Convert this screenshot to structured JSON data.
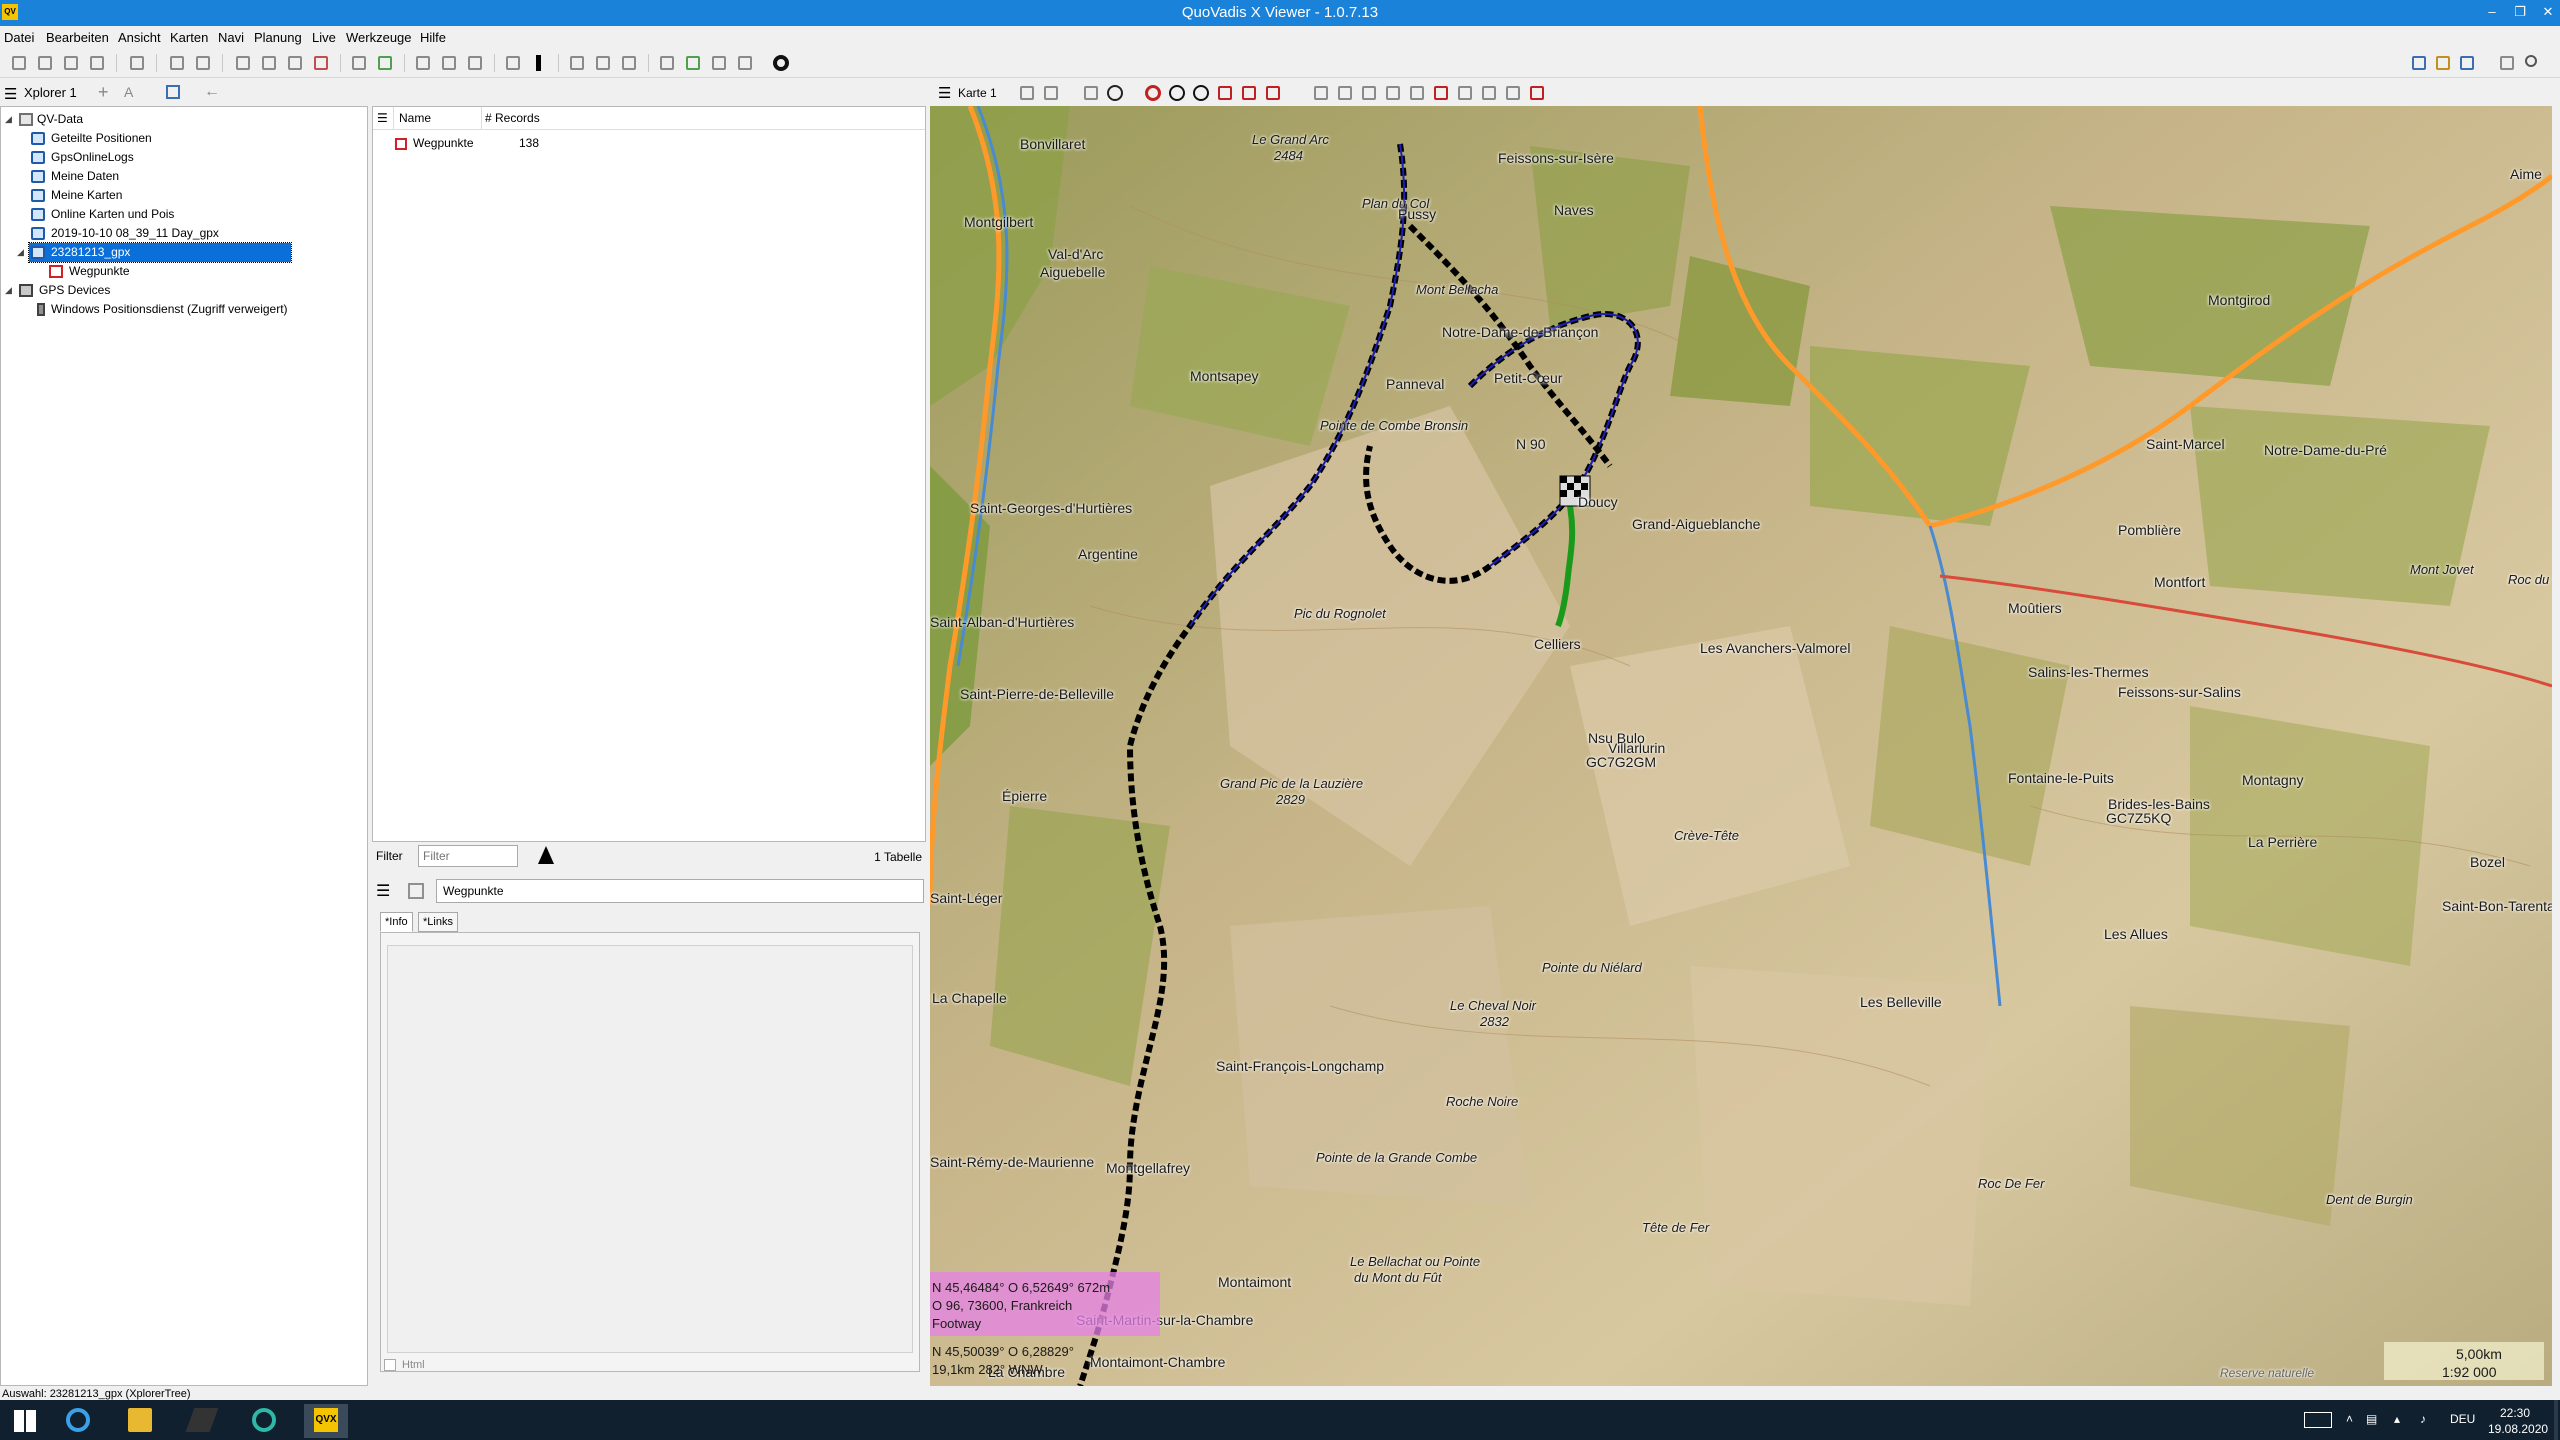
{
  "window": {
    "title": "QuoVadis X Viewer - 1.0.7.13",
    "app_badge": "QV"
  },
  "menu": [
    "Datei",
    "Bearbeiten",
    "Ansicht",
    "Karten",
    "Navi",
    "Planung",
    "Live",
    "Werkzeuge",
    "Hilfe"
  ],
  "explorer": {
    "title": "Xplorer 1",
    "tree": [
      {
        "label": "QV-Data",
        "level": 0,
        "icon": "folder-icon",
        "expanded": true
      },
      {
        "label": "Geteilte Positionen",
        "level": 1,
        "icon": "database-icon"
      },
      {
        "label": "GpsOnlineLogs",
        "level": 1,
        "icon": "database-icon"
      },
      {
        "label": "Meine Daten",
        "level": 1,
        "icon": "database-icon"
      },
      {
        "label": "Meine Karten",
        "level": 1,
        "icon": "database-icon"
      },
      {
        "label": "Online Karten und Pois",
        "level": 1,
        "icon": "database-icon"
      },
      {
        "label": "2019-10-10 08_39_11 Day_gpx",
        "level": 1,
        "icon": "database-icon"
      },
      {
        "label": "23281213_gpx",
        "level": 1,
        "icon": "database-icon",
        "selected": true,
        "expanded": true
      },
      {
        "label": "Wegpunkte",
        "level": 2,
        "icon": "waypoint-icon"
      },
      {
        "label": "GPS Devices",
        "level": 0,
        "icon": "device-icon",
        "expanded": true
      },
      {
        "label": "Windows Positionsdienst (Zugriff verweigert)",
        "level": 1,
        "icon": "phone-icon"
      }
    ]
  },
  "table": {
    "columns": [
      "Name",
      "# Records"
    ],
    "rows": [
      {
        "name": "Wegpunkte",
        "records": "138"
      }
    ]
  },
  "filter": {
    "label": "Filter",
    "placeholder": "Filter",
    "count": "1 Tabelle"
  },
  "detail": {
    "title": "Wegpunkte",
    "tabs": [
      "*Info",
      "*Links"
    ],
    "html_label": "Html"
  },
  "status": {
    "text": "Auswahl: 23281213_gpx   (XplorerTree)"
  },
  "map_panel": {
    "title": "Karte 1"
  },
  "map": {
    "labels": [
      "Bonvillaret",
      "Le Grand Arc",
      "2484",
      "Feissons-sur-Isère",
      "Plan du Col",
      "Pussy",
      "Naves",
      "Montgilbert",
      "Val-d'Arc",
      "Aiguebelle",
      "Mont Bellacha",
      "Notre-Dame-de-Briançon",
      "Montgirod",
      "Montsapey",
      "Pointe de Combe Bronsin",
      "Panneval",
      "Petit-Cœur",
      "Saint-Marcel",
      "Notre-Dame-du-Pré",
      "Saint-Georges-d'Hurtières",
      "Doucy",
      "Grand-Aigueblanche",
      "Pomblière",
      "Argentine",
      "Mont Jovet",
      "Montfort",
      "Roc du",
      "Pic du Rognolet",
      "Moûtiers",
      "Saint-Alban-d'Hurtières",
      "Celliers",
      "Les Avanchers-Valmorel",
      "Salins-les-Thermes",
      "Saint-Pierre-de-Belleville",
      "Feissons-sur-Salins",
      "Grand Pic de la Lauzière",
      "2829",
      "Fontaine-le-Puits",
      "Montagny",
      "Épierre",
      "Crève-Tête",
      "Brides-les-Bains",
      "La Perrière",
      "Bozel",
      "Saint-Léger",
      "Saint-Bon-Tarentaise",
      "Les Allues",
      "Pointe du Niélard",
      "La Chapelle",
      "Le Cheval Noir",
      "2832",
      "Les Belleville",
      "Saint-François-Longchamp",
      "Roche Noire",
      "Saint-Rémy-de-Maurienne",
      "Montgellafrey",
      "Pointe de la Grande Combe",
      "Roc De Fer",
      "Dent de Burgin",
      "Tête de Fer",
      "Montaimont",
      "Le Bellachat ou Pointe",
      "du Mont du Fût",
      "Saint-Martin-sur-la-Chambre",
      "Villarlurin",
      "GC7G2GM",
      "GC7Z5KQ",
      "Nsu Bulo",
      "N 90",
      "Aime",
      "Reserve naturelle",
      "Montaimont-Chambre",
      "La Chambre"
    ],
    "coords": [
      "N 45,46484° O 6,52649° 672m",
      "O 96, 73600, Frankreich",
      "Footway",
      "N 45,50039° O 6,28829°",
      "19,1km 282° WNW"
    ],
    "scale": {
      "distance": "5,00km",
      "ratio": "1:92 000"
    }
  },
  "taskbar": {
    "language": "DEU",
    "time": "22:30",
    "date": "19.08.2020",
    "qvx_label": "QVX"
  },
  "colors": {
    "titlebar": "#1a82d8",
    "selection": "#0a6fd8",
    "track_black": "#000000",
    "track_blue": "#1e1eb0",
    "track_green": "#1a9a1a",
    "coord_box": "#e682e6"
  }
}
